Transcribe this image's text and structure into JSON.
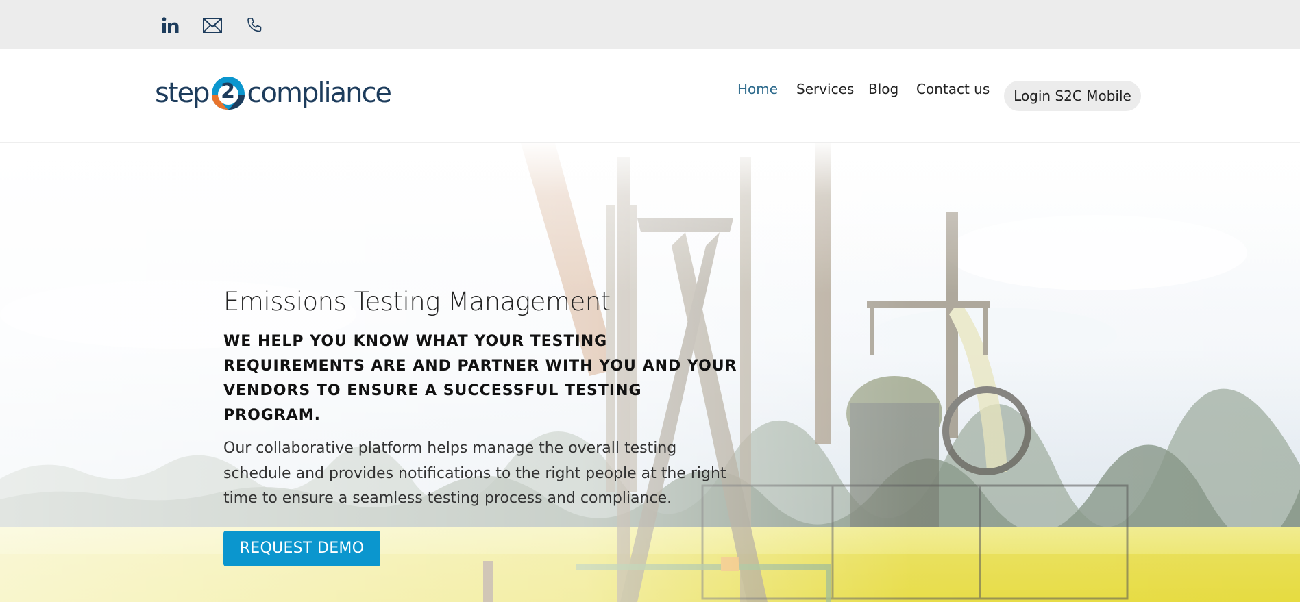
{
  "social": {
    "linkedin_icon": "linkedin-icon",
    "email_icon": "envelope-icon",
    "phone_icon": "phone-icon"
  },
  "logo": {
    "left_text": "step",
    "badge_text": "2",
    "right_text": "compliance"
  },
  "nav": {
    "items": [
      "Home",
      "Services",
      "Blog",
      "Contact us"
    ],
    "active": "Home",
    "login_label": "Login S2C Mobile"
  },
  "hero": {
    "title": "Emissions Testing Management",
    "subtitle": "WE HELP YOU KNOW WHAT YOUR TESTING REQUIREMENTS ARE AND PARTNER WITH YOU AND YOUR VENDORS TO ENSURE A SUCCESSFUL TESTING PROGRAM.",
    "body": "Our collaborative platform helps manage the overall testing schedule and provides notifications to the right people at the right time to ensure a seamless testing process and compliance.",
    "cta_label": "REQUEST DEMO"
  },
  "colors": {
    "topbar": "#ececec",
    "brand_navy": "#1d3c5c",
    "brand_blue": "#0b96ce",
    "brand_orange": "#e8742c",
    "nav_active": "#2d6a8c",
    "field_yellow": "#e9e04a"
  }
}
